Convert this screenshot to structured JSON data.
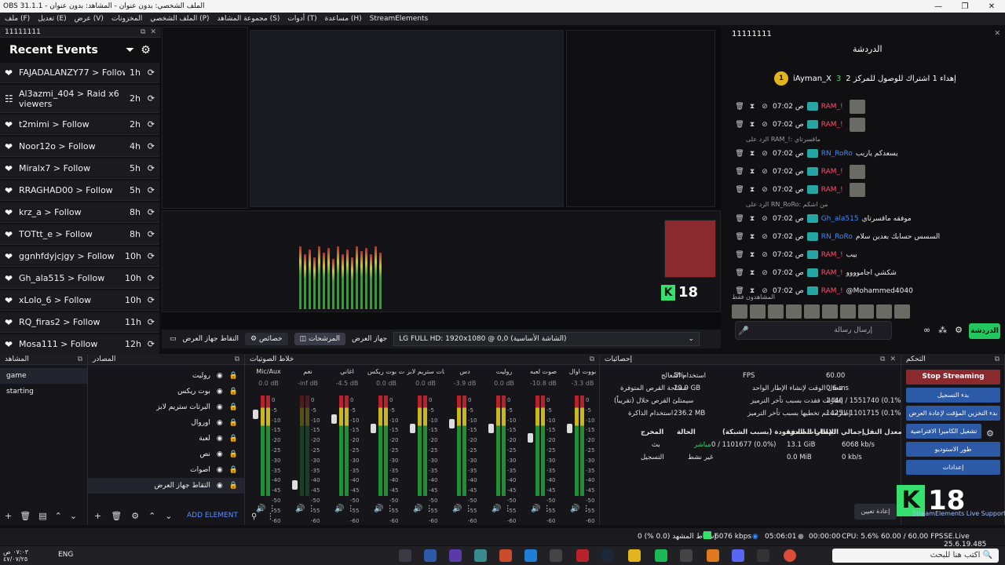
{
  "window": {
    "title": "OBS 31.1.1 - الملف الشخصي: بدون عنوان - المشاهد: بدون عنوان"
  },
  "menu": [
    "ملف (F)",
    "تعديل (E)",
    "عرض (V)",
    "المخزونات",
    "الملف الشخصي (P)",
    "مجموعة المشاهد (S)",
    "أدوات (T)",
    "مساعدة (H)",
    "StreamElements"
  ],
  "recent": {
    "dock_title": "11111111",
    "title": "Recent Events",
    "events": [
      {
        "text": "FAJADALANZY77 > Follow",
        "time": "1h",
        "icon": "heart-icon"
      },
      {
        "text": "Al3azmi_404 > Raid x6 viewers",
        "time": "2h",
        "icon": "raid-icon"
      },
      {
        "text": "t2mimi > Follow",
        "time": "2h",
        "icon": "heart-icon"
      },
      {
        "text": "Noor12o > Follow",
        "time": "4h",
        "icon": "heart-icon"
      },
      {
        "text": "Miralx7 > Follow",
        "time": "5h",
        "icon": "heart-icon"
      },
      {
        "text": "RRAGHAD00 > Follow",
        "time": "5h",
        "icon": "heart-icon"
      },
      {
        "text": "krz_a > Follow",
        "time": "8h",
        "icon": "heart-icon"
      },
      {
        "text": "TOTtt_e > Follow",
        "time": "8h",
        "icon": "heart-icon"
      },
      {
        "text": "ggnhfdyjcjgy > Follow",
        "time": "10h",
        "icon": "heart-icon"
      },
      {
        "text": "Gh_ala515 > Follow",
        "time": "10h",
        "icon": "heart-icon"
      },
      {
        "text": "xLolo_6 > Follow",
        "time": "10h",
        "icon": "heart-icon"
      },
      {
        "text": "RQ_firas2 > Follow",
        "time": "11h",
        "icon": "heart-icon"
      },
      {
        "text": "Mosa111 > Follow",
        "time": "12h",
        "icon": "heart-icon"
      }
    ]
  },
  "chat": {
    "dock_title": "11111111",
    "title": "الدردشة",
    "pinned_user": "iAyman_X",
    "pinned_count": "3",
    "pinned_text": "إهداء 1 اشتراك للوصول للمركز 2",
    "pinned_rank": "1",
    "messages": [
      {
        "kind": "msg",
        "time": "07:02 ص",
        "name": "RAM_!",
        "red": true,
        "text": ""
      },
      {
        "kind": "msg",
        "time": "07:02 ص",
        "name": "RAM_!",
        "red": true,
        "text": ""
      },
      {
        "kind": "reply",
        "text": "الرد على RAM_!: ماقسرتاي"
      },
      {
        "kind": "msg",
        "time": "07:02 ص",
        "name": "RN_RoRo",
        "red": false,
        "text": "يسعدكم ياربب"
      },
      {
        "kind": "msg",
        "time": "07:02 ص",
        "name": "RAM_!",
        "red": true,
        "text": ""
      },
      {
        "kind": "msg",
        "time": "07:02 ص",
        "name": "RAM_!",
        "red": true,
        "text": ""
      },
      {
        "kind": "reply",
        "text": "الرد على RN_RoRo: من اشكم"
      },
      {
        "kind": "msg",
        "time": "07:02 ص",
        "name": "Gh_ala515",
        "red": false,
        "text": "موفقه ماقسرتاي"
      },
      {
        "kind": "msg",
        "time": "07:02 ص",
        "name": "RN_RoRo",
        "red": false,
        "text": "السسس حسابك بعدين سلام"
      },
      {
        "kind": "msg",
        "time": "07:02 ص",
        "name": "RAM_!",
        "red": true,
        "text": "بيب"
      },
      {
        "kind": "msg",
        "time": "07:02 ص",
        "name": "RAM_!",
        "red": true,
        "text": "شكشي اجاموووو"
      },
      {
        "kind": "msg",
        "time": "07:02 ص",
        "name": "RAM_!",
        "red": true,
        "text": "@Mohammed4040"
      }
    ],
    "viewers_label": "المشاهدون فقط",
    "input_placeholder": "إرسال رسالة",
    "send_label": "الدردشة"
  },
  "preview_toolbar": {
    "zoom": "",
    "b1": "التقاط جهاز العرض",
    "b2": "خصائص",
    "b3": "المرشحات",
    "device_label": "جهاز العرض",
    "device": "LG FULL HD: 1920x1080 @ 0,0 (الشاشة الأساسية)"
  },
  "scenes": {
    "title": "المشاهد",
    "items": [
      "game",
      "starting"
    ]
  },
  "sources": {
    "title": "المصادر",
    "items": [
      "روليت",
      "بوت ريكس",
      "البرتات ستريم لابز",
      "اوروال",
      "لعبة",
      "نص",
      "اصوات",
      "التقاط جهاز العرض"
    ],
    "add_label": "ADD ELEMENT"
  },
  "mixer": {
    "title": "خلاط الصوتيات",
    "channels": [
      {
        "name": "Mic/Aux",
        "db": "0.0 dB",
        "level": 0.85,
        "active": true
      },
      {
        "name": "نغم",
        "db": "-inf dB",
        "level": 0.1,
        "active": false
      },
      {
        "name": "اغاني",
        "db": "-4.5 dB",
        "level": 0.8,
        "active": true
      },
      {
        "name": "البرتات بوت ريكس",
        "db": "0.0 dB",
        "level": 0.7,
        "active": true
      },
      {
        "name": "البرتات ستريم لابز",
        "db": "0.0 dB",
        "level": 0.7,
        "active": true
      },
      {
        "name": "دس",
        "db": "-3.9 dB",
        "level": 0.75,
        "active": true
      },
      {
        "name": "روليت",
        "db": "0.0 dB",
        "level": 0.7,
        "active": true
      },
      {
        "name": "صوت لعبه",
        "db": "-10.8 dB",
        "level": 0.6,
        "active": true
      },
      {
        "name": "بووت اوال",
        "db": "-3.3 dB",
        "level": 0.7,
        "active": true
      }
    ],
    "scale": [
      "0",
      "-5",
      "-10",
      "-15",
      "-20",
      "-25",
      "-30",
      "-35",
      "-40",
      "-45",
      "-50",
      "-55",
      "-60"
    ]
  },
  "stats": {
    "title": "إحصائيات",
    "cpu_label": "استخدام المعالج",
    "cpu": "5%",
    "fps_label": "FPS",
    "fps": "60.00",
    "disk_label": "مساحة القرص المتوفرة",
    "disk": "29.9 GB",
    "render_label": "معدل الوقت لإنشاء الإطار الواحد",
    "render": "0.6 ms",
    "diskfull_label": "سيمتلئ القرص خلال (تقريباً)",
    "diskfull": "",
    "skipped_label": "إطارات فقدت بسبب تأخر الترميز",
    "skipped": "1446 / 1551740 (0.1%)",
    "mem_label": "استخدام الذاكرة",
    "mem": "236.2 MB",
    "missed_label": "إطارات تم تخطيها بسبب تأخر الترميز",
    "missed": "1425 / 1101715 (0.1%)",
    "h_output": "المخرج",
    "h_status": "الحالة",
    "h_drop": "الإطارات المفقودة (بسبب الشبكة)",
    "h_total": "إجمالي البيانات الصادرة",
    "h_bitrate": "معدل النقل",
    "row1": {
      "output": "بث",
      "status": "مباشر",
      "drop": "0 / 1101677 (0.0%)",
      "total": "13.1 GiB",
      "bitrate": "6068 kb/s"
    },
    "row2": {
      "output": "التسجيل",
      "status": "غير نشط",
      "drop": "",
      "total": "0.0 MiB",
      "bitrate": "0 kb/s"
    },
    "reset_label": "إعادة تعيين"
  },
  "controls": {
    "title": "التحكم",
    "buttons": [
      "Stop Streaming",
      "بدء التسجيل",
      "بدء التخزين المؤقت لإعادة العرض",
      "تشغيل الكاميرا الافتراضية",
      "طور الاستوديو",
      "إعدادات"
    ],
    "support": "StreamElements Live Support",
    "logo_num": "18"
  },
  "status": {
    "dropped": "إسقاط المشهد (0.0 %) 0",
    "kbps": "6076 kbps",
    "live": "05:06:01",
    "rec": "00:00:00",
    "cpu": "CPU: 5.6%",
    "fps": "60.00 / 60.00 FPS",
    "se": "SE.Live 25.6.19.485"
  },
  "taskbar": {
    "search": "اكتب هنا للبحث",
    "lang": "ENG",
    "time": "٠٧:٠٣ ص",
    "date": "٤٧/٠٧/٢٥"
  },
  "colors": {
    "accent": "#2d5aa6",
    "live": "#35e06d",
    "stop": "#8a2a2f"
  }
}
